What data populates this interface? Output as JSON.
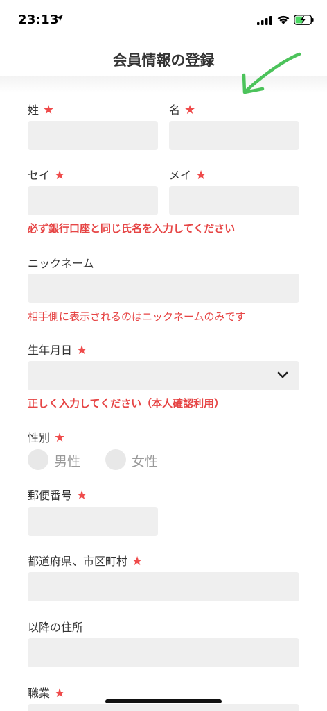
{
  "status": {
    "time": "23:13"
  },
  "header": {
    "title": "会員情報の登録"
  },
  "form": {
    "last_name": "姓",
    "first_name": "名",
    "last_kana": "セイ",
    "first_kana": "メイ",
    "name_note": "必ず銀行口座と同じ氏名を入力してください",
    "nickname": "ニックネーム",
    "nickname_note": "相手側に表示されるのはニックネームのみです",
    "birthday": "生年月日",
    "birthday_note": "正しく入力してください（本人確認利用）",
    "gender": "性別",
    "gender_options": [
      "男性",
      "女性"
    ],
    "postal": "郵便番号",
    "prefecture_city": "都道府県、市区町村",
    "address": "以降の住所",
    "occupation": "職業"
  },
  "required_mark": "★",
  "colors": {
    "required": "#ef4b4b",
    "note": "#e64545",
    "field_bg": "#efefef",
    "arrow": "#4cc35b"
  },
  "icons": [
    "location-arrow-icon",
    "signal-icon",
    "wifi-icon",
    "battery-charging-icon",
    "chevron-down-icon",
    "arrow-annotation-icon"
  ]
}
